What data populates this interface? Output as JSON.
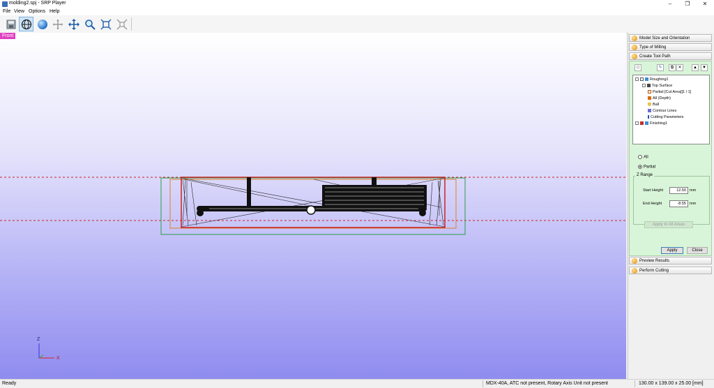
{
  "window": {
    "title": "molding2.spj - SRP Player"
  },
  "menu": [
    "File",
    "View",
    "Options",
    "Help"
  ],
  "toolbar": {
    "tools": [
      "save",
      "globe-view",
      "sphere",
      "rotate",
      "pan",
      "zoom",
      "fit",
      "zoom-extents"
    ]
  },
  "viewport": {
    "label": "Front",
    "axes": {
      "z": "Z",
      "x": "X"
    }
  },
  "side": {
    "sections_top": [
      "Model Size and Orientation",
      "Type of Milling",
      "Create Tool Path"
    ],
    "tree": [
      {
        "label": "Roughing1",
        "level": 0
      },
      {
        "label": "Top Surface",
        "level": 1
      },
      {
        "label": "Partial [Cut Area][1 / 1]",
        "level": 1
      },
      {
        "label": "All (Depth)",
        "level": 1
      },
      {
        "label": "Ball",
        "level": 1
      },
      {
        "label": "Contour Lines",
        "level": 1
      },
      {
        "label": "Cutting Parameters",
        "level": 1
      },
      {
        "label": "Finishing1",
        "level": 0
      }
    ],
    "radio_all": "All",
    "radio_partial": "Partial",
    "zrange_label": "Z Range",
    "start_height_label": "Start Height",
    "start_height_value": "12.50",
    "end_height_label": "End Height",
    "end_height_value": "-8.55",
    "unit": "mm",
    "apply_all_label": "Apply to All Areas",
    "apply_label": "Apply",
    "close_label": "Close",
    "sections_bottom": [
      "Preview Results",
      "Perform Cutting"
    ]
  },
  "status": {
    "left": "Ready",
    "machine": "MDX-40A, ATC not present, Rotary Axis Unit not present",
    "dims": "130.00 x 139.00 x 25.00 [mm]"
  }
}
